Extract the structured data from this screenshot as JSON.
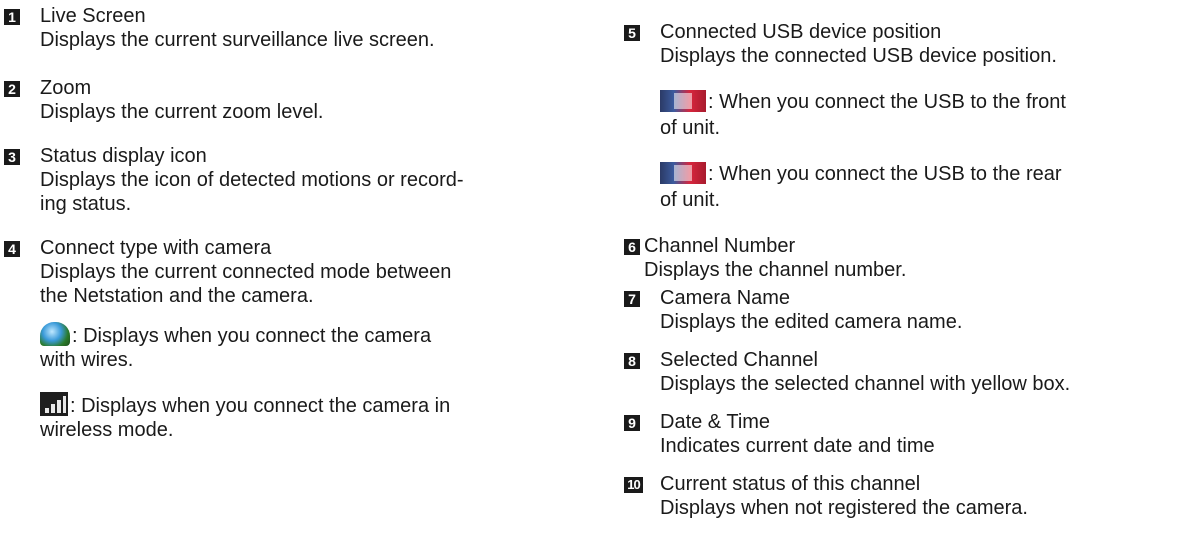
{
  "left_column": {
    "items": [
      {
        "number": "1",
        "title": "Live Screen",
        "lines": [
          "Displays the current surveillance live screen."
        ]
      },
      {
        "number": "2",
        "title": "Zoom",
        "lines": [
          "Displays the current zoom level."
        ]
      },
      {
        "number": "3",
        "title": "Status display icon",
        "lines": [
          "Displays the icon of detected motions or record-",
          "ing status."
        ]
      },
      {
        "number": "4",
        "title": "Connect type with camera",
        "lines": [
          "Displays the current connected mode between",
          "the Netstation and the camera."
        ],
        "notes": [
          {
            "icon": "globe-network-icon",
            "line1": ": Displays when you connect the camera",
            "line2": "with wires."
          },
          {
            "icon": "wireless-signal-icon",
            "line1": ": Displays when you connect the camera in",
            "line2": "wireless mode."
          }
        ]
      }
    ]
  },
  "right_column": {
    "items": [
      {
        "number": "5",
        "title": "Connected USB device position",
        "lines": [
          "Displays the connected USB device position."
        ],
        "notes": [
          {
            "icon": "usb-front-icon",
            "line1": ": When you connect the USB to the front",
            "line2": "of unit."
          },
          {
            "icon": "usb-rear-icon",
            "line1": ": When you connect the USB to the rear",
            "line2": "of unit."
          }
        ]
      },
      {
        "number": "6",
        "title": "Channel Number",
        "lines": [
          "Displays the channel number."
        ]
      },
      {
        "number": "7",
        "title": "Camera Name",
        "lines": [
          "Displays the edited camera name."
        ]
      },
      {
        "number": "8",
        "title": "Selected Channel",
        "lines": [
          "Displays the selected channel with yellow box."
        ]
      },
      {
        "number": "9",
        "title": "Date & Time",
        "lines": [
          "Indicates current date and time"
        ]
      },
      {
        "number": "10",
        "title": "Current status of this channel",
        "lines": [
          "Displays when not registered the camera."
        ]
      }
    ]
  }
}
